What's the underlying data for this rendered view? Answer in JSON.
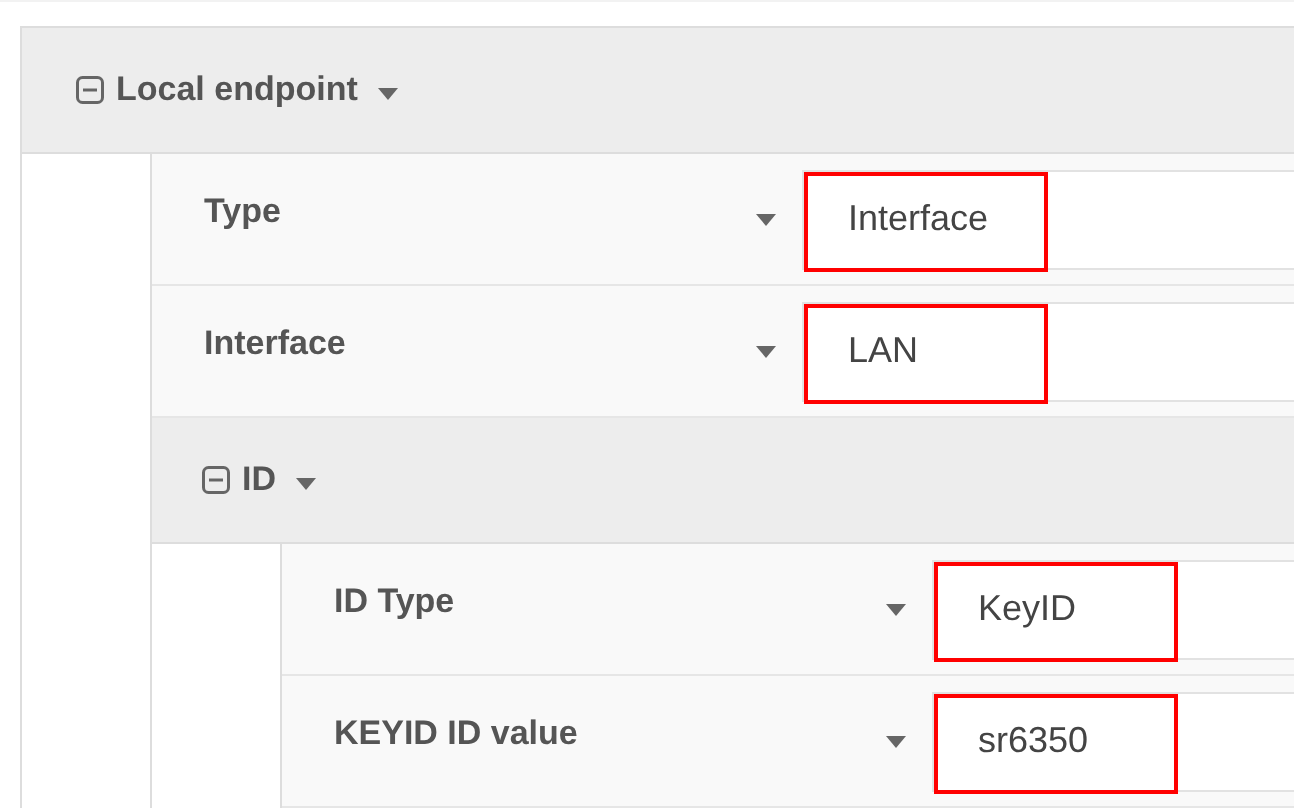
{
  "section": {
    "title": "Local endpoint",
    "expanded": true,
    "items": [
      {
        "kind": "field",
        "label": "Type",
        "value": "Interface",
        "highlighted": true
      },
      {
        "kind": "field",
        "label": "Interface",
        "value": "LAN",
        "highlighted": true
      },
      {
        "kind": "section",
        "title": "ID",
        "expanded": true,
        "items": [
          {
            "kind": "field",
            "label": "ID Type",
            "value": "KeyID",
            "highlighted": true
          },
          {
            "kind": "field",
            "label": "KEYID ID value",
            "value": "sr6350",
            "highlighted": true
          }
        ]
      }
    ]
  }
}
